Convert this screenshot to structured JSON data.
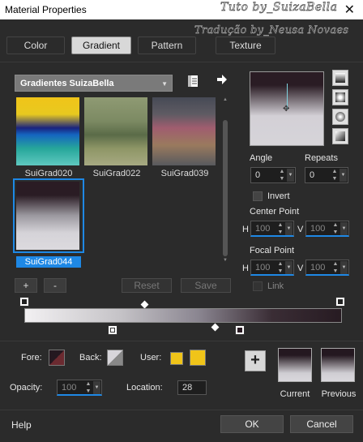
{
  "window": {
    "title": "Material Properties",
    "close": "✕"
  },
  "watermark": {
    "line1": "Tuto by_SuizaBella",
    "line2": "Tradução by_Neusa Novaes"
  },
  "tabs": [
    {
      "label": "Color"
    },
    {
      "label": "Gradient"
    },
    {
      "label": "Pattern"
    },
    {
      "label": "Texture"
    }
  ],
  "library": {
    "dropdown": "Gradientes SuizaBella"
  },
  "swatches": [
    {
      "label": "SuiGrad020"
    },
    {
      "label": "SuiGrad022"
    },
    {
      "label": "SuiGrad039"
    },
    {
      "label": "SuiGrad044"
    }
  ],
  "swatch_buttons": {
    "add": "+",
    "remove": "-",
    "reset": "Reset",
    "save": "Save"
  },
  "angle": {
    "label": "Angle",
    "value": "0"
  },
  "repeats": {
    "label": "Repeats",
    "value": "0"
  },
  "invert": {
    "label": "Invert"
  },
  "center_point": {
    "label": "Center Point",
    "h_label": "H",
    "h": "100",
    "v_label": "V",
    "v": "100"
  },
  "focal_point": {
    "label": "Focal Point",
    "h_label": "H",
    "h": "100",
    "v_label": "V",
    "v": "100"
  },
  "link": {
    "label": "Link"
  },
  "bottom": {
    "fore_label": "Fore:",
    "back_label": "Back:",
    "user_label": "User:",
    "opacity_label": "Opacity:",
    "opacity": "100",
    "location_label": "Location:",
    "location": "28",
    "current_label": "Current",
    "previous_label": "Previous",
    "add": "+"
  },
  "footer": {
    "help": "Help",
    "ok": "OK",
    "cancel": "Cancel"
  },
  "colors": {
    "accent": "#1e88e5",
    "user_yellow": "#f0c419"
  }
}
